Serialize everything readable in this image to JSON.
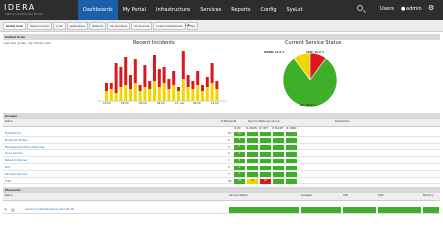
{
  "brand": {
    "logo": "IDERA",
    "subtitle": "Uptime Infrastructure Monitor"
  },
  "nav": [
    "Dashboards",
    "My Portal",
    "Infrastructure",
    "Services",
    "Reports",
    "Config",
    "SysLst"
  ],
  "header": {
    "users": "Users",
    "user": "admin"
  },
  "subtabs": [
    "Global Scan",
    "Resource Scan",
    "S Lst",
    "Applications",
    "Network",
    "SLI Summary",
    "All Services",
    "Custom Dashboards",
    "Play"
  ],
  "subtab_more": "▸ ▪",
  "global_scan": {
    "title": "Global Scan",
    "crumb": "Last data update - My Infrastructure"
  },
  "recent_incidents": {
    "title": "Recent Incidents",
    "x_ticks": [
      "12:00",
      "18:00",
      "00:00",
      "06:00",
      "21. Apr",
      "06:00",
      "12:00"
    ]
  },
  "service_status": {
    "title": "Current Service Status",
    "labels": {
      "warn": "WARN: 10.0 %",
      "crit": "CRIT: 10.0 %",
      "ok": "OK: 80.0 %"
    },
    "values": {
      "ok": 80,
      "warn": 10,
      "crit": 10
    }
  },
  "groups": {
    "title": "Groups",
    "col_name": "Name",
    "col_elements": "# Elements",
    "col_status": "Service Status by Group",
    "col_desc": "Description",
    "status_heads": [
      "# OK",
      "# WARN",
      "# CRIT",
      "# MAINT",
      "# UNKN"
    ],
    "rows": [
      {
        "name": "MyPlatforms",
        "count": "10",
        "cells": [
          "10",
          "",
          "",
          "",
          ""
        ]
      },
      {
        "name": "Monitored Nodes",
        "count": "6",
        "cells": [
          "6",
          "",
          "",
          "",
          ""
        ]
      },
      {
        "name": "Management Virtual Machines",
        "count": "3",
        "cells": [
          "3",
          "",
          "",
          "",
          ""
        ]
      },
      {
        "name": "Linux Servers",
        "count": "4",
        "cells": [
          "4",
          "",
          "",
          "",
          ""
        ]
      },
      {
        "name": "Network Devices",
        "count": "2",
        "cells": [
          "2",
          "",
          "",
          "",
          ""
        ]
      },
      {
        "name": "NLS",
        "count": "4",
        "cells": [
          "4",
          "",
          "",
          "",
          ""
        ]
      },
      {
        "name": "Windows Servers",
        "count": "7",
        "cells": [
          "7",
          "",
          "",
          "",
          ""
        ]
      },
      {
        "name": "Total",
        "count": "36",
        "cells": [
          "20",
          "10",
          "10",
          "",
          ""
        ]
      }
    ]
  },
  "elements": {
    "title": "Elements",
    "col_name": "Name",
    "col_status": "Service Status",
    "col_outages": "Outages",
    "col_cpu": "CPU",
    "col_disk": "Disk",
    "col_memory": "Memory",
    "row_name": "server1.myinfrastructure (10.0.30.32)"
  },
  "colors": {
    "ok": "#3fae29",
    "warn": "#f2d600",
    "crit": "#d9181f",
    "nav_active": "#1c5fa8"
  }
}
